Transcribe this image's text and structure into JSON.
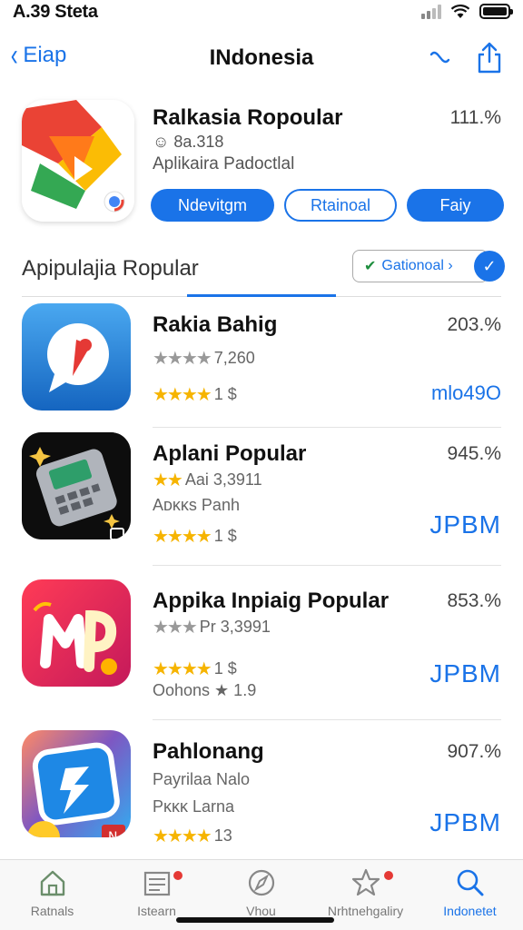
{
  "status": {
    "time": "A.39 Steta"
  },
  "nav": {
    "back_label": "Eiap",
    "title": "INdonesia"
  },
  "featured": {
    "name": "Ralkasia Ropoular",
    "percent": "111.%",
    "rating": "☺ 8a.318",
    "subtitle": "Aplikaira Padoctlal",
    "buttons": [
      "Ndevitgm",
      "Rtainoal",
      "Faiy"
    ]
  },
  "section": {
    "title": "Apipulajia Ropular",
    "filter_label": "Gationoal ›"
  },
  "apps": [
    {
      "name": "Rakia Bahig",
      "percent": "203.%",
      "line1_stars": "★★★★",
      "line1_text": "7,260",
      "line2_stars": "★★★★",
      "line2_text": "1 $",
      "badge": "mlo49O"
    },
    {
      "name": "Aplani Popular",
      "percent": "945.%",
      "line1_stars": "★★",
      "line1_text": "Aai 3,3911",
      "line2_text": "Aᴅᴋᴋs Panh",
      "line3_stars": "★★★★",
      "line3_text": "1 $",
      "badge": "JPBM"
    },
    {
      "name": "Appika Inpiaig Popular",
      "percent": "853.%",
      "line1_stars": "★★★",
      "line1_text": "Pr 3,3991",
      "line2_stars": "★★★★",
      "line2_text": "1 $",
      "line3_text": "Oohons ★ 1.9",
      "badge": "JPBM"
    },
    {
      "name": "Pahlonang",
      "percent": "907.%",
      "line1_text": "Payrilaa Nalo",
      "line2_text": "Pᴋᴋᴋ Larna",
      "line3_stars": "★★★★",
      "line3_text": "13",
      "badge": "JPBM"
    }
  ],
  "tabs": [
    {
      "label": "Ratnals"
    },
    {
      "label": "Istearn"
    },
    {
      "label": "Vhou"
    },
    {
      "label": "Nrhtnehgaliry"
    },
    {
      "label": "Indonetet"
    }
  ],
  "colors": {
    "accent": "#1a73e8",
    "star": "#f6b400",
    "badge_dot": "#e53935"
  }
}
